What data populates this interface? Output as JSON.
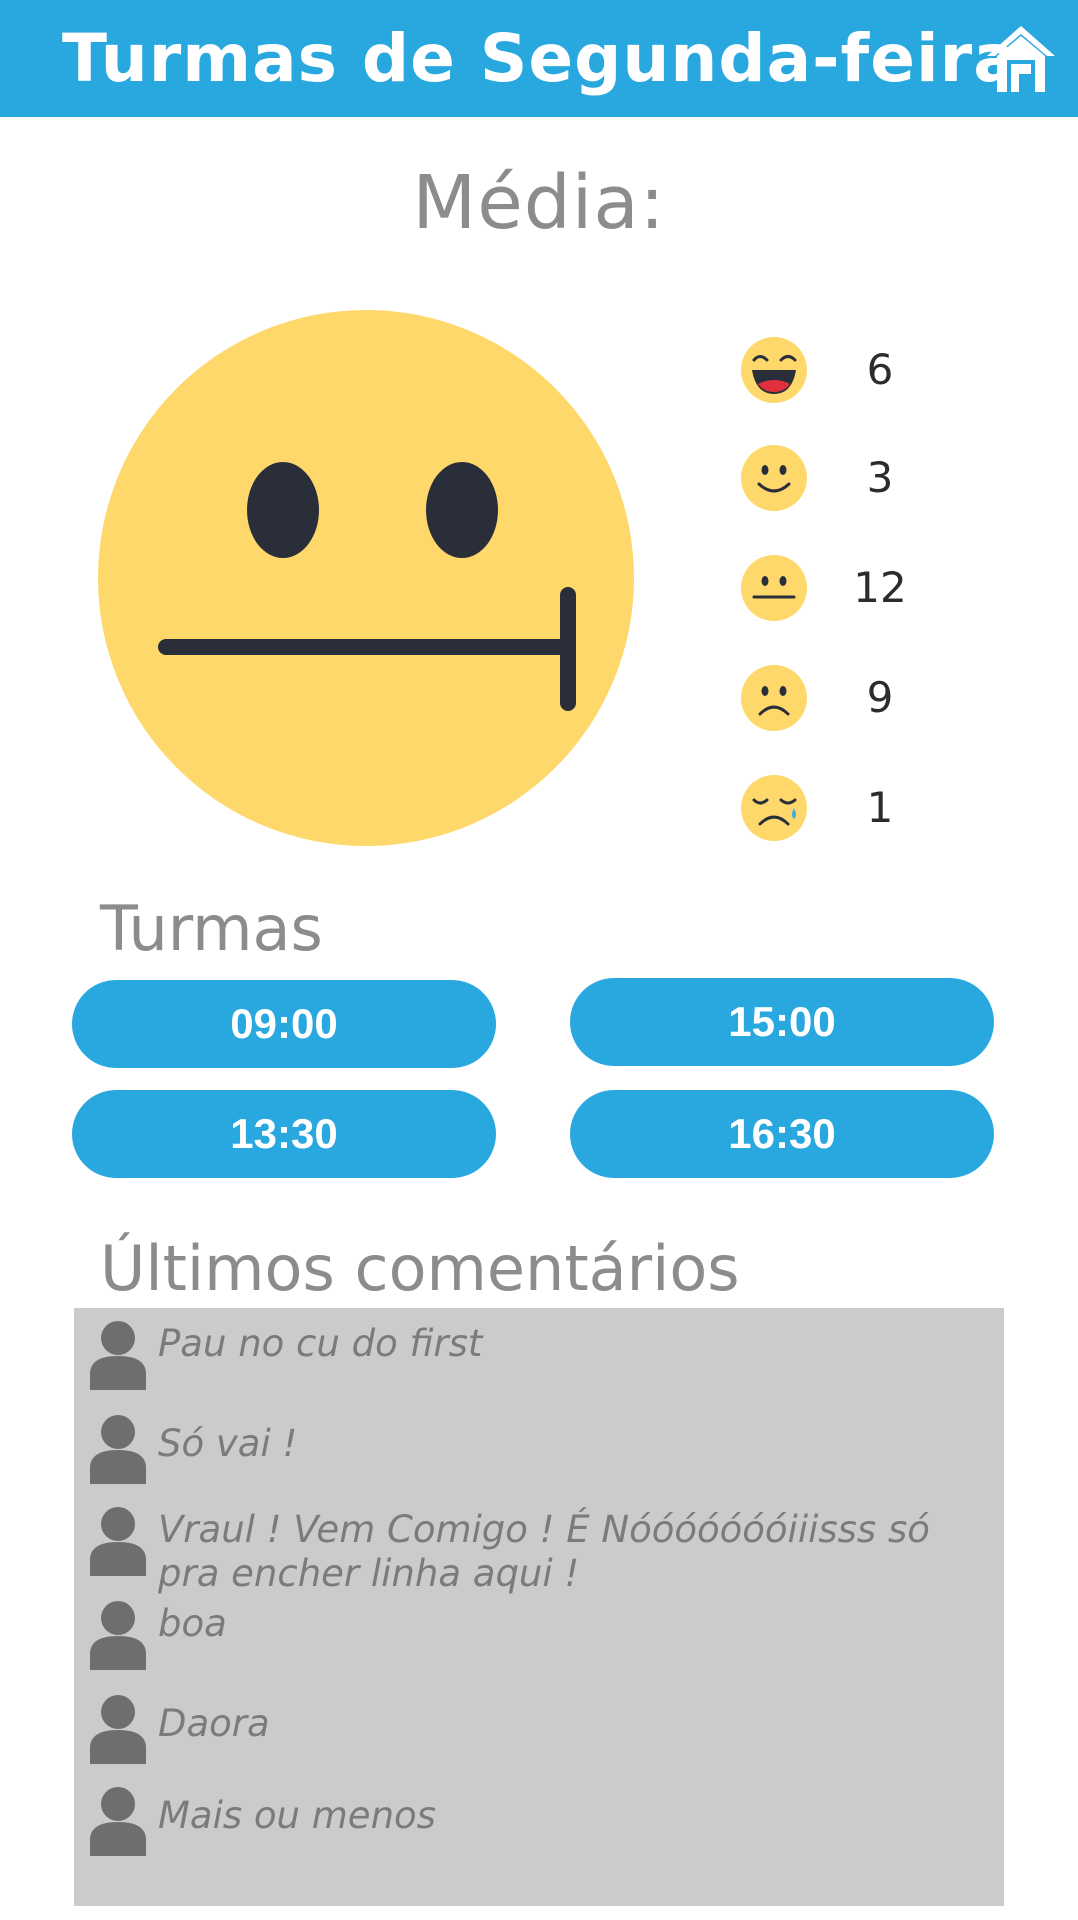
{
  "header": {
    "title": "Turmas de Segunda-feira",
    "home_icon": "home-icon",
    "background": "#29a8e0"
  },
  "average": {
    "label": "Média:",
    "icon": "neutral-face-icon"
  },
  "ratings": [
    {
      "icon": "laughing-face-icon",
      "count": "6"
    },
    {
      "icon": "smiling-face-icon",
      "count": "3"
    },
    {
      "icon": "neutral-face-icon",
      "count": "12"
    },
    {
      "icon": "frowning-face-icon",
      "count": "9"
    },
    {
      "icon": "crying-face-icon",
      "count": "1"
    }
  ],
  "classes": {
    "title": "Turmas",
    "slots": [
      "09:00",
      "15:00",
      "13:30",
      "16:30"
    ]
  },
  "comments": {
    "title": "Últimos comentários",
    "items": [
      "Pau no cu do first",
      "Só vai !",
      "Vraul ! Vem Comigo !  É Nóóóóóóóiiisss só pra encher linha aqui !",
      "boa",
      "Daora",
      "Mais ou menos"
    ]
  },
  "colors": {
    "accent": "#29a8e0",
    "face": "#fed86b",
    "face_features": "#2a2e38",
    "comment_bg": "#cbcbcb",
    "avatar": "#6e6e6e"
  }
}
